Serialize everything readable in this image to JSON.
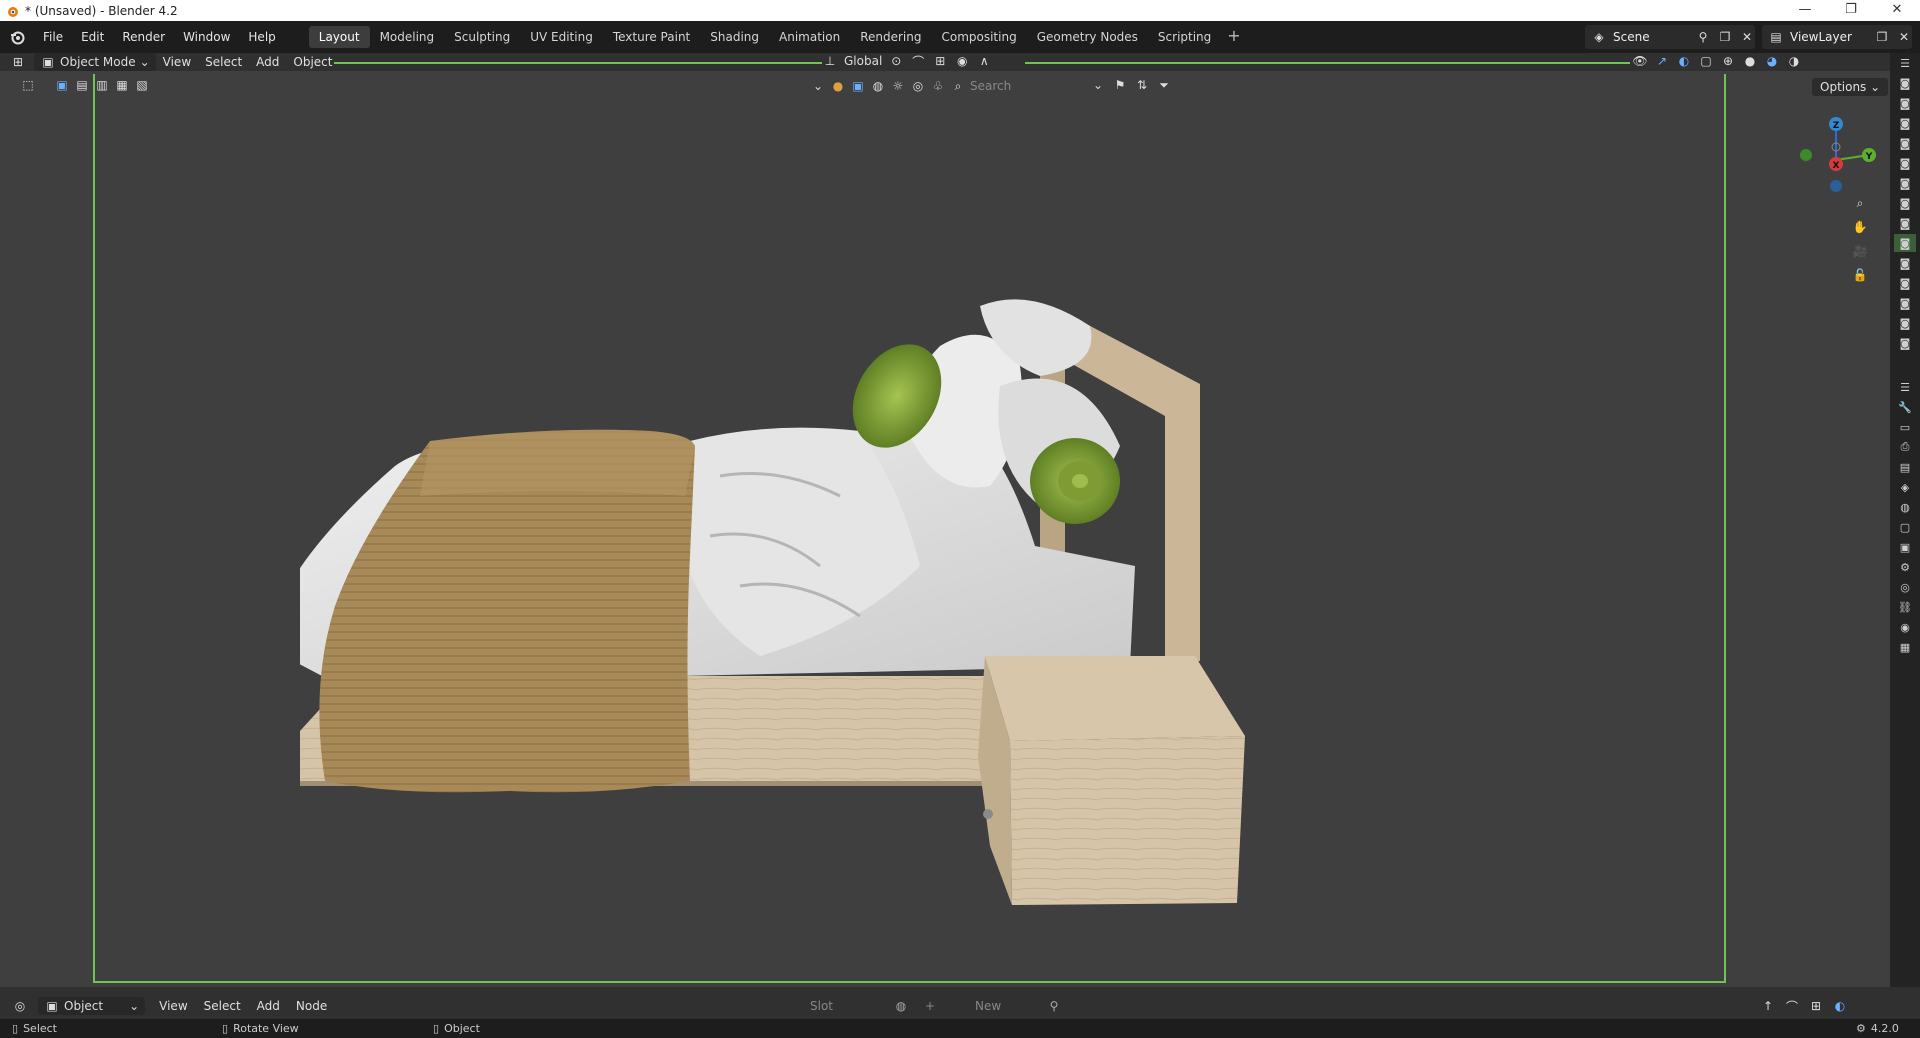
{
  "window": {
    "title": "* (Unsaved) - Blender 4.2",
    "controls": [
      "—",
      "❐",
      "✕"
    ]
  },
  "menu": [
    "File",
    "Edit",
    "Render",
    "Window",
    "Help"
  ],
  "workspaces": [
    {
      "label": "Layout",
      "active": true
    },
    {
      "label": "Modeling"
    },
    {
      "label": "Sculpting"
    },
    {
      "label": "UV Editing"
    },
    {
      "label": "Texture Paint"
    },
    {
      "label": "Shading"
    },
    {
      "label": "Animation"
    },
    {
      "label": "Rendering"
    },
    {
      "label": "Compositing"
    },
    {
      "label": "Geometry Nodes"
    },
    {
      "label": "Scripting"
    }
  ],
  "scene": {
    "name": "Scene",
    "view_layer": "ViewLayer"
  },
  "viewport_header": {
    "mode": "Object Mode",
    "menus": [
      "View",
      "Select",
      "Add",
      "Object"
    ],
    "orientation": "Global",
    "search_placeholder": "Search",
    "options": "Options"
  },
  "gizmo_labels": {
    "z": "Z",
    "y": "Y",
    "x": "X"
  },
  "shader_header": {
    "editor": "Object",
    "menus": [
      "View",
      "Select",
      "Add",
      "Node"
    ],
    "slot": "Slot",
    "new": "New"
  },
  "status": {
    "select": "Select",
    "rotate": "Rotate View",
    "object": "Object",
    "version": "4.2.0"
  },
  "colors": {
    "accent_green": "#71c257",
    "bg_dark": "#1d1d1d",
    "viewport_bg": "#3f3f3f",
    "active_tab": "#3d3d3d"
  }
}
